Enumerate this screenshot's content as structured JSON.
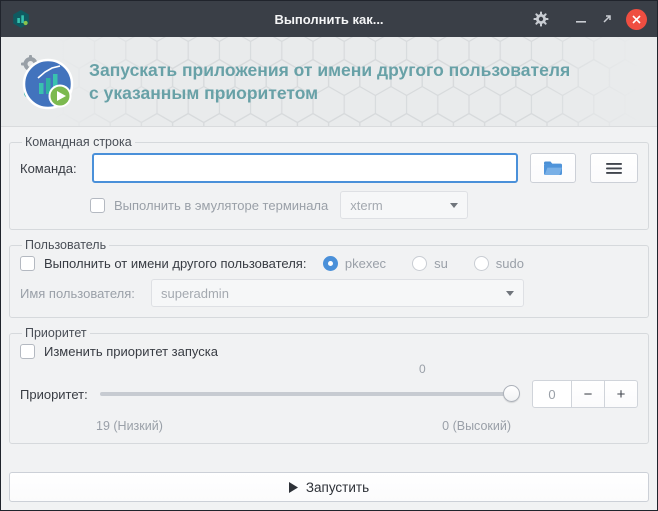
{
  "window": {
    "title": "Выполнить как..."
  },
  "colors": {
    "accent": "#4a90d9",
    "titlebar": "#3a3f47",
    "header_text": "#68a1a7",
    "close_button": "#ef4e41"
  },
  "header": {
    "title_line1": "Запускать приложения от имени другого пользователя",
    "title_line2": "с указанным приоритетом"
  },
  "command_group": {
    "legend": "Командная строка",
    "command_label": "Команда:",
    "command_value": "",
    "terminal_checkbox": "Выполнить в эмуляторе терминала",
    "terminal_emulator": "xterm"
  },
  "user_group": {
    "legend": "Пользователь",
    "run_as_checkbox": "Выполнить от имени другого пользователя:",
    "auth_options": [
      {
        "label": "pkexec",
        "selected": true
      },
      {
        "label": "su",
        "selected": false
      },
      {
        "label": "sudo",
        "selected": false
      }
    ],
    "username_label": "Имя пользователя:",
    "username": "superadmin"
  },
  "priority_group": {
    "legend": "Приоритет",
    "change_checkbox": "Изменить приоритет запуска",
    "priority_label": "Приоритет:",
    "slider_value": "0",
    "spin_value": "0",
    "minus": "−",
    "plus": "+",
    "low": "19 (Низкий)",
    "high": "0 (Высокий)"
  },
  "run_button": {
    "label": "Запустить"
  },
  "icons": {
    "titlebar": [
      "app-icon",
      "gear-icon",
      "minimize-icon",
      "restore-icon",
      "close-icon"
    ],
    "command_row": [
      "folder-icon",
      "menu-icon"
    ],
    "dropdowns": "chevron-down-icon",
    "run": "play-icon"
  }
}
